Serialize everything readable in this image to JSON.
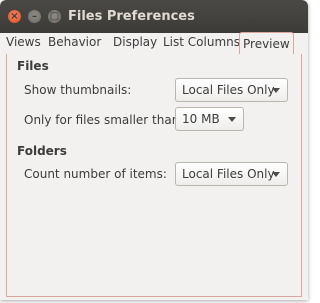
{
  "window": {
    "title": "Files Preferences",
    "controls": {
      "close": "×",
      "minimize": "–",
      "maximize": "□"
    }
  },
  "tabs": [
    {
      "label": "Views"
    },
    {
      "label": "Behavior"
    },
    {
      "label": "Display"
    },
    {
      "label": "List Columns"
    },
    {
      "label": "Preview",
      "active": true
    }
  ],
  "files_section": {
    "heading": "Files",
    "show_thumbnails_label": "Show thumbnails:",
    "show_thumbnails_value": "Local Files Only",
    "size_limit_label": "Only for files smaller than:",
    "size_limit_value": "10 MB"
  },
  "folders_section": {
    "heading": "Folders",
    "count_items_label": "Count number of items:",
    "count_items_value": "Local Files Only"
  },
  "colors": {
    "titlebar": "#3c3b37",
    "close_button": "#df4a16",
    "active_tab_border": "#d9a6a0",
    "window_background": "#f2f1f0"
  }
}
